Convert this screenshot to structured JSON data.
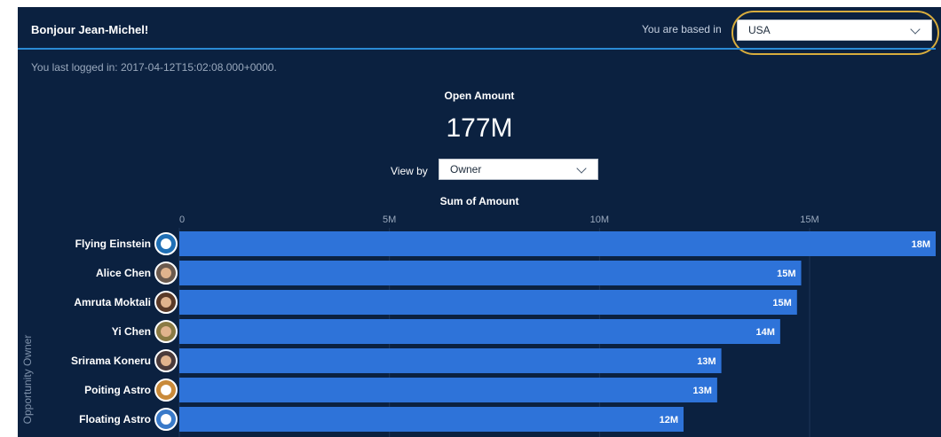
{
  "header": {
    "greeting": "Bonjour Jean-Michel!",
    "based_label": "You are based in",
    "country_value": "USA"
  },
  "last_login": "You last logged in: 2017-04-12T15:02:08.000+0000.",
  "metric": {
    "label": "Open Amount",
    "value": "177M"
  },
  "view_by": {
    "label": "View by",
    "value": "Owner"
  },
  "chart_data": {
    "type": "bar",
    "orientation": "horizontal",
    "title": "Sum of Amount",
    "ylabel": "Opportunity Owner",
    "xlabel": "",
    "xlim": [
      0,
      18
    ],
    "ticks": [
      {
        "value": 0,
        "label": "0"
      },
      {
        "value": 5,
        "label": "5M"
      },
      {
        "value": 10,
        "label": "10M"
      },
      {
        "value": 15,
        "label": "15M"
      }
    ],
    "grid": true,
    "bar_color": "#2e73d9",
    "categories": [
      "Flying Einstein",
      "Alice Chen",
      "Amruta Moktali",
      "Yi Chen",
      "Srirama Koneru",
      "Poiting Astro",
      "Floating Astro"
    ],
    "values": [
      18,
      14.8,
      14.7,
      14.3,
      12.9,
      12.8,
      12.0
    ],
    "value_labels": [
      "18M",
      "15M",
      "15M",
      "14M",
      "13M",
      "13M",
      "12M"
    ]
  },
  "avatars": [
    {
      "icon": "astro-avatar-icon",
      "color": "#1f6fb5"
    },
    {
      "icon": "person-avatar-icon",
      "color": "#6b5a4e"
    },
    {
      "icon": "person-avatar-icon",
      "color": "#5a3a28"
    },
    {
      "icon": "person-avatar-icon",
      "color": "#8a7a44"
    },
    {
      "icon": "person-avatar-icon",
      "color": "#4b3b3b"
    },
    {
      "icon": "astro-avatar-icon",
      "color": "#c98a3a"
    },
    {
      "icon": "astro-avatar-icon",
      "color": "#3a7ac9"
    }
  ],
  "colors": {
    "background": "#0b2140",
    "accent_line": "#2b8bd6",
    "highlight_ring": "#d7ac3d"
  }
}
